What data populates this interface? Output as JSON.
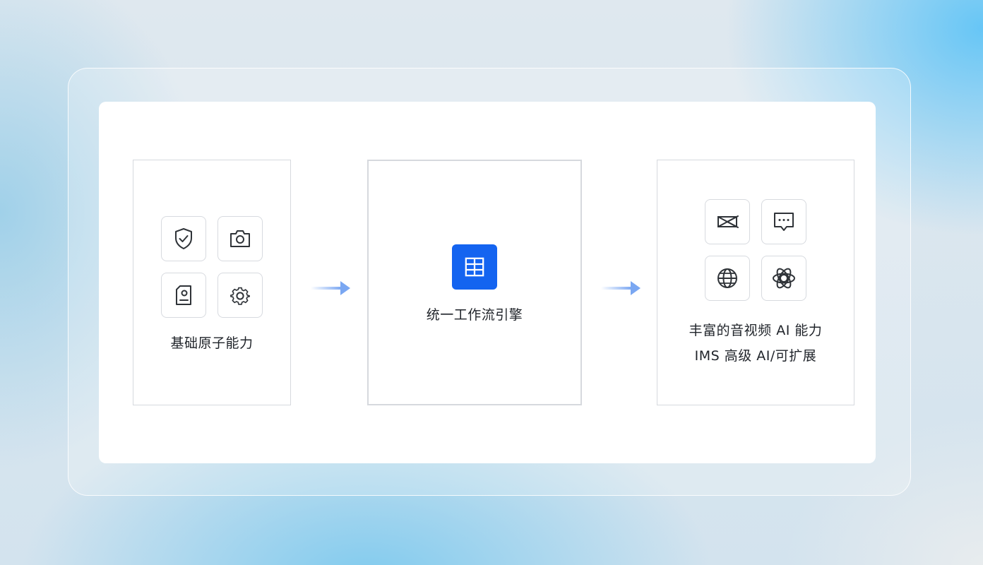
{
  "colors": {
    "accent": "#1464f0",
    "arrow": "#7aa7f2",
    "border": "#d6d9de",
    "text": "#1f2329",
    "icon_stroke": "#2f3338"
  },
  "left_panel": {
    "label": "基础原子能力",
    "icons": [
      "shield-check-icon",
      "camera-icon",
      "document-user-icon",
      "gear-icon"
    ]
  },
  "center_panel": {
    "label": "统一工作流引擎",
    "icon": "table-grid-icon"
  },
  "right_panel": {
    "line1": "丰富的音视频 AI 能力",
    "line2": "IMS 高级 AI/可扩展",
    "icons": [
      "video-cut-icon",
      "chat-bubble-icon",
      "globe-icon",
      "atom-icon"
    ]
  },
  "arrows": [
    "arrow-right-icon",
    "arrow-right-icon"
  ]
}
